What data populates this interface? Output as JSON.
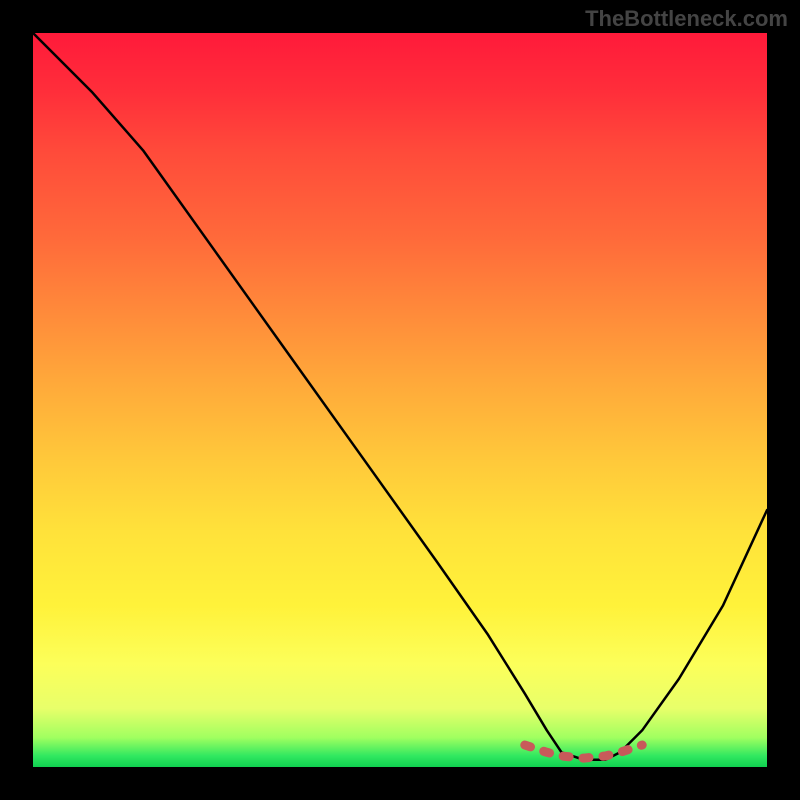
{
  "watermark": "TheBottleneck.com",
  "chart_data": {
    "type": "line",
    "title": "",
    "xlabel": "",
    "ylabel": "",
    "xlim": [
      0,
      100
    ],
    "ylim": [
      0,
      100
    ],
    "series": [
      {
        "name": "bottleneck-curve",
        "x": [
          0,
          3,
          8,
          15,
          25,
          35,
          45,
          55,
          62,
          67,
          70,
          72,
          75,
          78,
          80,
          83,
          88,
          94,
          100
        ],
        "y": [
          100,
          97,
          92,
          84,
          70,
          56,
          42,
          28,
          18,
          10,
          5,
          2,
          1,
          1,
          2,
          5,
          12,
          22,
          35
        ],
        "color": "#000000"
      },
      {
        "name": "optimal-range-marker",
        "x": [
          67,
          70,
          72,
          75,
          78,
          80,
          83
        ],
        "y": [
          3,
          2,
          1.5,
          1.2,
          1.5,
          2,
          3
        ],
        "color": "#c85a5a"
      }
    ],
    "gradient_stops": [
      {
        "pos": 0,
        "color": "#ff1a3a"
      },
      {
        "pos": 50,
        "color": "#ffaa3a"
      },
      {
        "pos": 80,
        "color": "#fff23a"
      },
      {
        "pos": 100,
        "color": "#10d050"
      }
    ]
  }
}
